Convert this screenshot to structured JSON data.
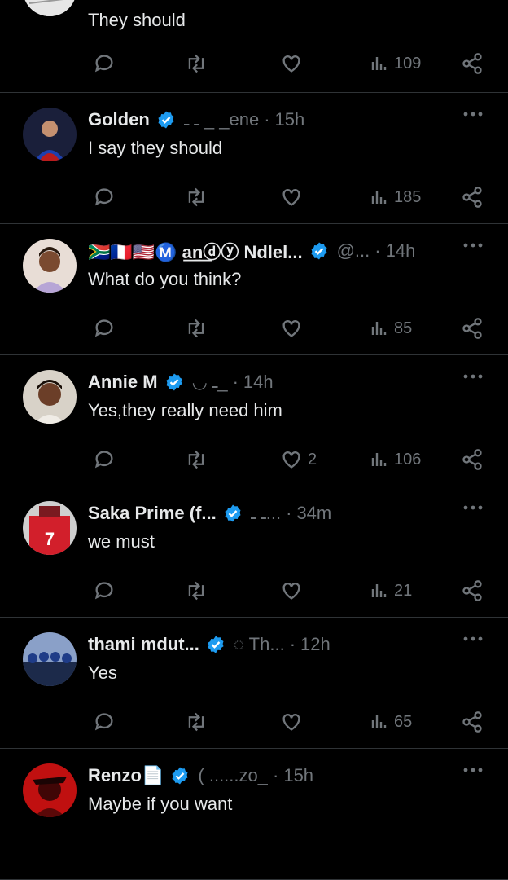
{
  "colors": {
    "background": "#000000",
    "text": "#e7e9ea",
    "muted": "#71767b",
    "verified": "#1d9bf0",
    "divider": "#2f3336"
  },
  "tweets": [
    {
      "name": "",
      "handle": "",
      "time": "",
      "text": "They should",
      "likes": "",
      "views": "109"
    },
    {
      "name": "Golden",
      "handle": "ـ ـ         _ _ene",
      "time": "15h",
      "text": "I say they should",
      "likes": "",
      "views": "185"
    },
    {
      "name": "🇿🇦🇫🇷🇺🇸Ⓜ️ a͟n͟ⓓⓨ Ndlel...",
      "handle": "@...",
      "time": "14h",
      "text": "What do you think?",
      "likes": "",
      "views": "85"
    },
    {
      "name": "Annie M",
      "handle": "◡                        ـ_",
      "time": "14h",
      "text": "Yes,they really need him",
      "likes": "2",
      "views": "106"
    },
    {
      "name": "Saka Prime (f...",
      "handle": "ـ                 ـ...",
      "time": "34m",
      "text": "we must",
      "likes": "",
      "views": "21"
    },
    {
      "name": "thami mdut...",
      "handle": "◌                  Th...",
      "time": "12h",
      "text": "Yes",
      "likes": "",
      "views": "65"
    },
    {
      "name": "Renzo📄",
      "handle": "(          ......zo_",
      "time": "15h",
      "text": "Maybe if you want",
      "likes": "",
      "views": ""
    }
  ],
  "icons": {
    "reply": "reply-icon",
    "retweet": "retweet-icon",
    "like": "heart-icon",
    "views": "views-icon",
    "share": "share-icon",
    "more": "more-icon",
    "verified": "verified-badge-icon"
  }
}
